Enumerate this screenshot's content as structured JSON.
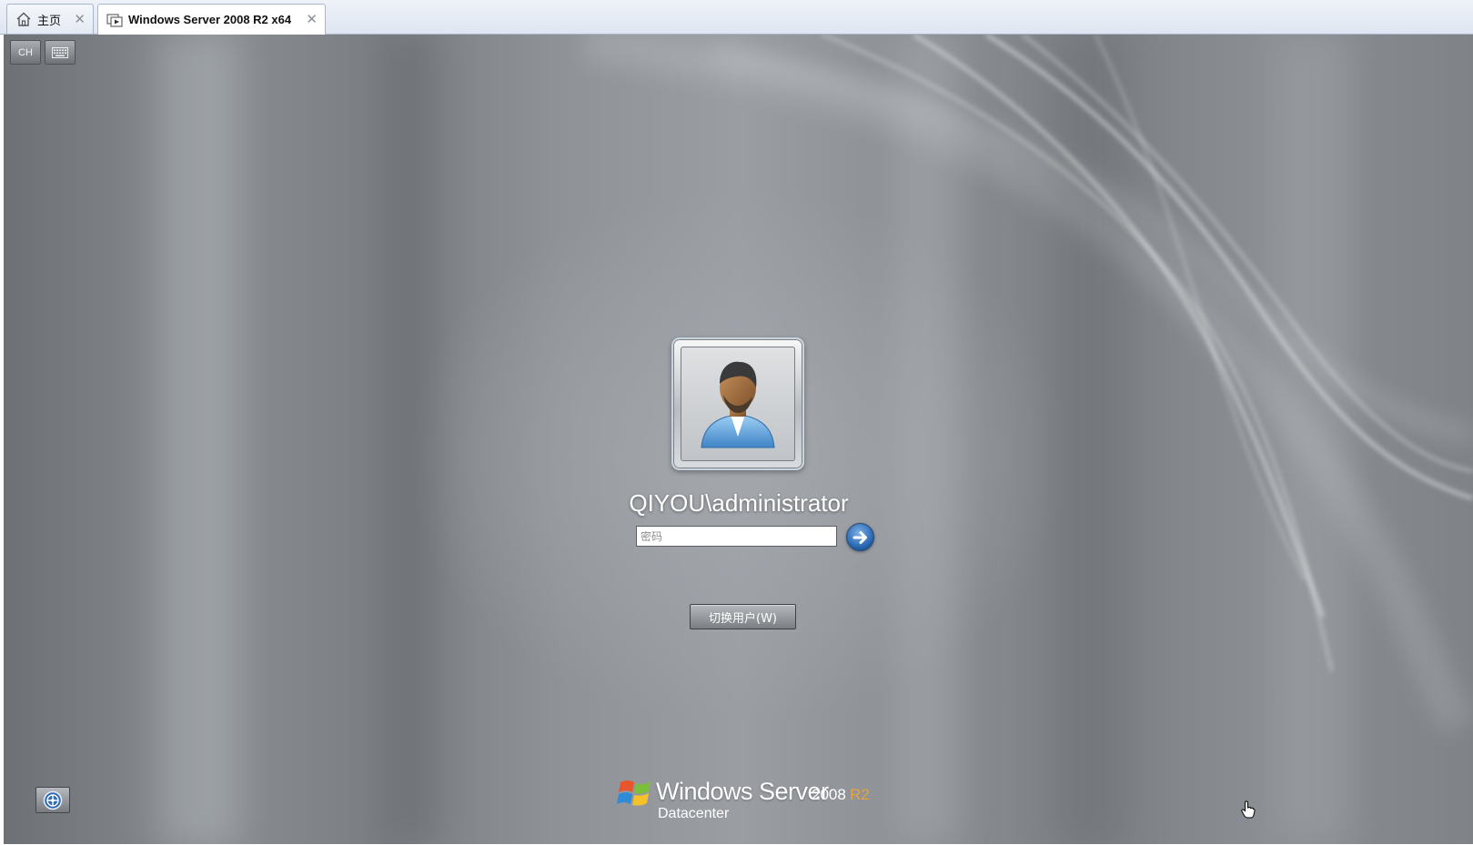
{
  "tabs": [
    {
      "label": "主页",
      "icon": "home-icon",
      "active": false
    },
    {
      "label": "Windows Server 2008 R2 x64",
      "icon": "vm-icon",
      "active": true
    }
  ],
  "toolbar": {
    "ime_label": "CH",
    "keyboard_icon": "keyboard-icon"
  },
  "logon": {
    "username": "QIYOU\\administrator",
    "password_placeholder": "密码",
    "password_value": "",
    "submit_icon": "arrow-right-icon",
    "switch_user_label": "切换用户(W)"
  },
  "ease_of_access_icon": "ease-of-access-icon",
  "brand": {
    "windows": "Windows Server",
    "year": "2008",
    "release": "R2",
    "edition": "Datacenter"
  },
  "colors": {
    "background": "#8a8e93",
    "brand_accent": "#e8a33b",
    "submit_blue": "#1f5ea8"
  }
}
